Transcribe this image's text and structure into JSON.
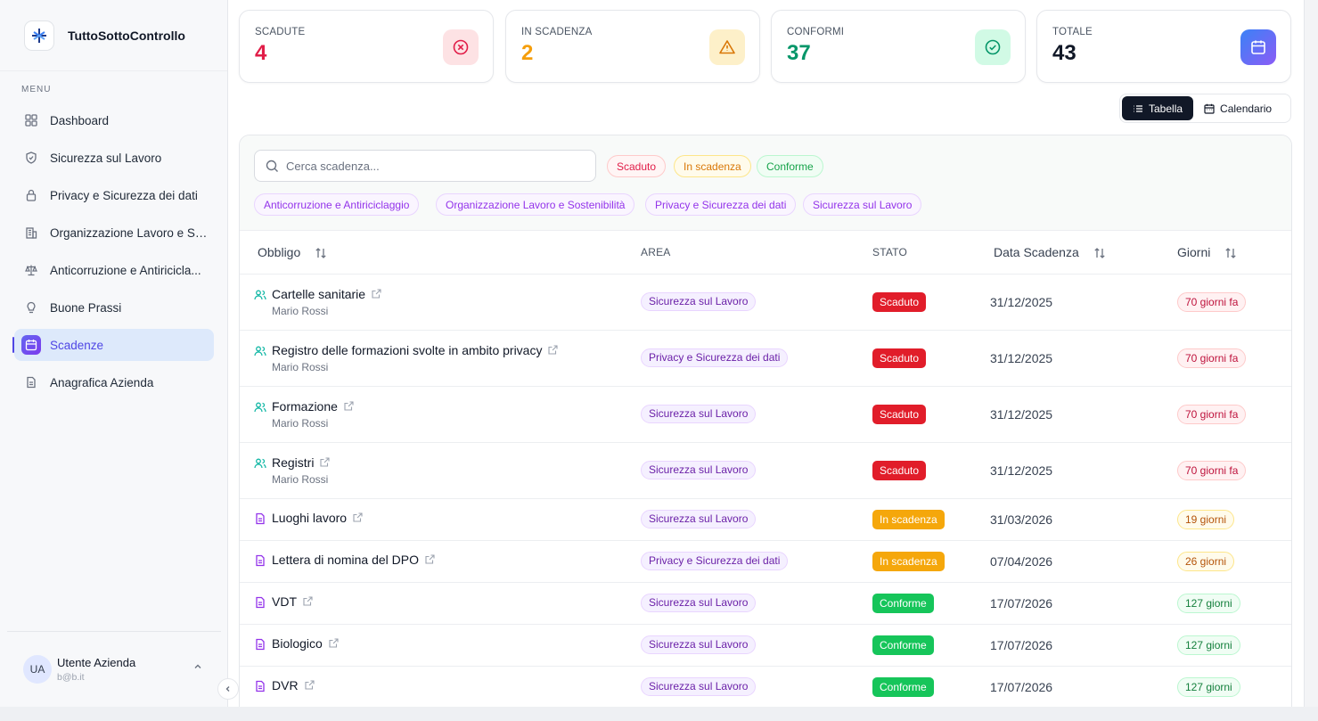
{
  "brand": {
    "name": "TuttoSottoControllo"
  },
  "sidebar": {
    "menu_title": "MENU",
    "items": [
      {
        "label": "Dashboard",
        "icon": "grid-icon"
      },
      {
        "label": "Sicurezza sul Lavoro",
        "icon": "shield-icon"
      },
      {
        "label": "Privacy e Sicurezza dei dati",
        "icon": "lock-icon"
      },
      {
        "label": "Organizzazione Lavoro e So...",
        "icon": "building-icon"
      },
      {
        "label": "Anticorruzione e Antiricicla...",
        "icon": "scale-icon"
      },
      {
        "label": "Buone Prassi",
        "icon": "lightbulb-icon"
      },
      {
        "label": "Scadenze",
        "icon": "calendar-icon",
        "active": true
      },
      {
        "label": "Anagrafica Azienda",
        "icon": "document-icon"
      }
    ],
    "user": {
      "initials": "UA",
      "name": "Utente Azienda",
      "email": "b@b.it"
    }
  },
  "stats": [
    {
      "label": "SCADUTE",
      "value": "4",
      "color": "#e11d48",
      "icon": "x-circle-icon"
    },
    {
      "label": "IN SCADENZA",
      "value": "2",
      "color": "#f59e0b",
      "icon": "warning-icon"
    },
    {
      "label": "CONFORMI",
      "value": "37",
      "color": "#059669",
      "icon": "check-circle-icon"
    },
    {
      "label": "TOTALE",
      "value": "43",
      "color": "#111827",
      "icon": "calendar-icon"
    }
  ],
  "view_toggle": {
    "table": "Tabella",
    "calendar": "Calendario"
  },
  "search": {
    "placeholder": "Cerca scadenza..."
  },
  "status_filters": [
    "Scaduto",
    "In scadenza",
    "Conforme"
  ],
  "area_filters": [
    "Anticorruzione e Antiriciclaggio",
    "Organizzazione Lavoro e Sostenibilità",
    "Privacy e Sicurezza dei dati",
    "Sicurezza sul Lavoro"
  ],
  "table": {
    "headers": {
      "obligation": "Obbligo",
      "area": "AREA",
      "status": "STATO",
      "due_date": "Data Scadenza",
      "days": "Giorni"
    },
    "rows": [
      {
        "title": "Cartelle sanitarie",
        "person": "Mario Rossi",
        "icon": "users-icon",
        "area": "Sicurezza sul Lavoro",
        "status": "Scaduto",
        "status_kind": "red",
        "date": "31/12/2025",
        "days": "70 giorni fa",
        "days_kind": "red"
      },
      {
        "title": "Registro delle formazioni svolte in ambito privacy",
        "person": "Mario Rossi",
        "icon": "users-icon",
        "area": "Privacy e Sicurezza dei dati",
        "status": "Scaduto",
        "status_kind": "red",
        "date": "31/12/2025",
        "days": "70 giorni fa",
        "days_kind": "red"
      },
      {
        "title": "Formazione",
        "person": "Mario Rossi",
        "icon": "users-icon",
        "area": "Sicurezza sul Lavoro",
        "status": "Scaduto",
        "status_kind": "red",
        "date": "31/12/2025",
        "days": "70 giorni fa",
        "days_kind": "red"
      },
      {
        "title": "Registri",
        "person": "Mario Rossi",
        "icon": "users-icon",
        "area": "Sicurezza sul Lavoro",
        "status": "Scaduto",
        "status_kind": "red",
        "date": "31/12/2025",
        "days": "70 giorni fa",
        "days_kind": "red"
      },
      {
        "title": "Luoghi lavoro",
        "person": "",
        "icon": "file-icon",
        "area": "Sicurezza sul Lavoro",
        "status": "In scadenza",
        "status_kind": "amber",
        "date": "31/03/2026",
        "days": "19 giorni",
        "days_kind": "amber"
      },
      {
        "title": "Lettera di nomina del DPO",
        "person": "",
        "icon": "file-icon",
        "area": "Privacy e Sicurezza dei dati",
        "status": "In scadenza",
        "status_kind": "amber",
        "date": "07/04/2026",
        "days": "26 giorni",
        "days_kind": "amber"
      },
      {
        "title": "VDT",
        "person": "",
        "icon": "file-icon",
        "area": "Sicurezza sul Lavoro",
        "status": "Conforme",
        "status_kind": "green",
        "date": "17/07/2026",
        "days": "127 giorni",
        "days_kind": "green"
      },
      {
        "title": "Biologico",
        "person": "",
        "icon": "file-icon",
        "area": "Sicurezza sul Lavoro",
        "status": "Conforme",
        "status_kind": "green",
        "date": "17/07/2026",
        "days": "127 giorni",
        "days_kind": "green"
      },
      {
        "title": "DVR",
        "person": "",
        "icon": "file-icon",
        "area": "Sicurezza sul Lavoro",
        "status": "Conforme",
        "status_kind": "green",
        "date": "17/07/2026",
        "days": "127 giorni",
        "days_kind": "green"
      }
    ]
  }
}
